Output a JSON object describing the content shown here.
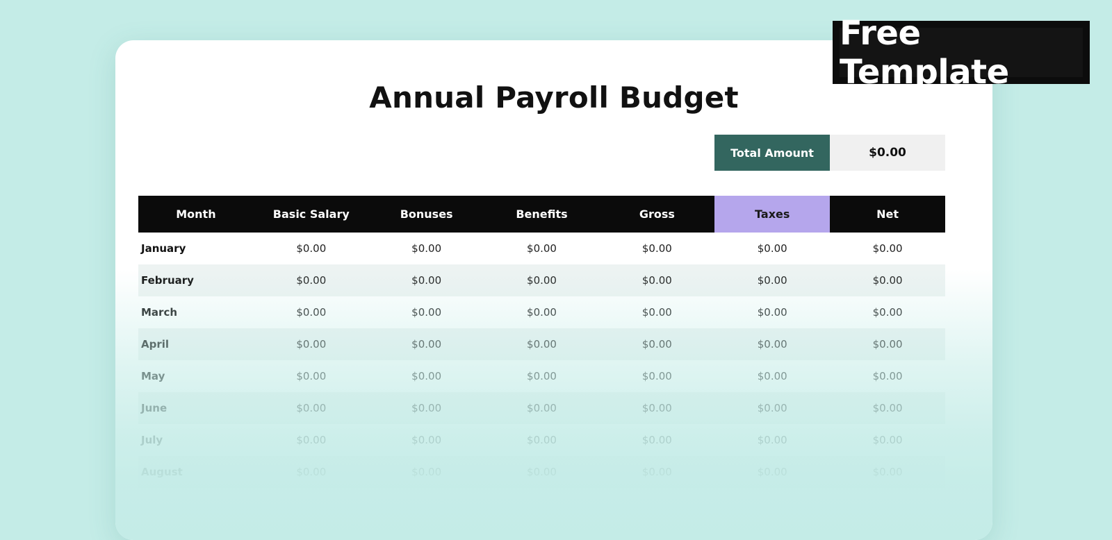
{
  "badge": {
    "label": "Free Template"
  },
  "sheet": {
    "title": "Annual Payroll Budget",
    "total_label": "Total Amount",
    "total_value": "$0.00",
    "columns": [
      "Month",
      "Basic Salary",
      "Bonuses",
      "Benefits",
      "Gross",
      "Taxes",
      "Net"
    ],
    "rows": [
      {
        "month": "January",
        "values": [
          "$0.00",
          "$0.00",
          "$0.00",
          "$0.00",
          "$0.00",
          "$0.00"
        ]
      },
      {
        "month": "February",
        "values": [
          "$0.00",
          "$0.00",
          "$0.00",
          "$0.00",
          "$0.00",
          "$0.00"
        ]
      },
      {
        "month": "March",
        "values": [
          "$0.00",
          "$0.00",
          "$0.00",
          "$0.00",
          "$0.00",
          "$0.00"
        ]
      },
      {
        "month": "April",
        "values": [
          "$0.00",
          "$0.00",
          "$0.00",
          "$0.00",
          "$0.00",
          "$0.00"
        ]
      },
      {
        "month": "May",
        "values": [
          "$0.00",
          "$0.00",
          "$0.00",
          "$0.00",
          "$0.00",
          "$0.00"
        ]
      },
      {
        "month": "June",
        "values": [
          "$0.00",
          "$0.00",
          "$0.00",
          "$0.00",
          "$0.00",
          "$0.00"
        ]
      },
      {
        "month": "July",
        "values": [
          "$0.00",
          "$0.00",
          "$0.00",
          "$0.00",
          "$0.00",
          "$0.00"
        ]
      },
      {
        "month": "August",
        "values": [
          "$0.00",
          "$0.00",
          "$0.00",
          "$0.00",
          "$0.00",
          "$0.00"
        ]
      }
    ]
  },
  "colors": {
    "background": "#c4ece7",
    "header_bg": "#0b0b0b",
    "taxes_header_bg": "#b5a6ec",
    "total_label_bg": "#33665f",
    "total_value_bg": "#f0f0f0",
    "alt_row_bg": "#edf3f2"
  }
}
